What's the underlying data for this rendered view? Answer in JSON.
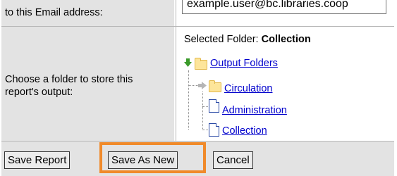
{
  "email_row": {
    "label": "to this Email address:",
    "input_value": "example.user@bc.libraries.coop"
  },
  "folder_row": {
    "label": "Choose a folder to store this report's output:",
    "selected_prefix": "Selected Folder:",
    "selected_value": "Collection",
    "tree": {
      "root": "Output Folders",
      "children": [
        "Circulation",
        "Administration",
        "Collection"
      ]
    }
  },
  "buttons": {
    "save_report": "Save Report",
    "save_as_new": "Save As New",
    "cancel": "Cancel"
  },
  "colors": {
    "label_bg": "#e3e3e3",
    "link": "#0000cc",
    "highlight": "#f08a2a"
  },
  "icons": {
    "root_expand": "green-down-arrow-icon",
    "child_expand": "gray-right-arrow-icon",
    "folder": "folder-icon",
    "document": "document-icon"
  }
}
